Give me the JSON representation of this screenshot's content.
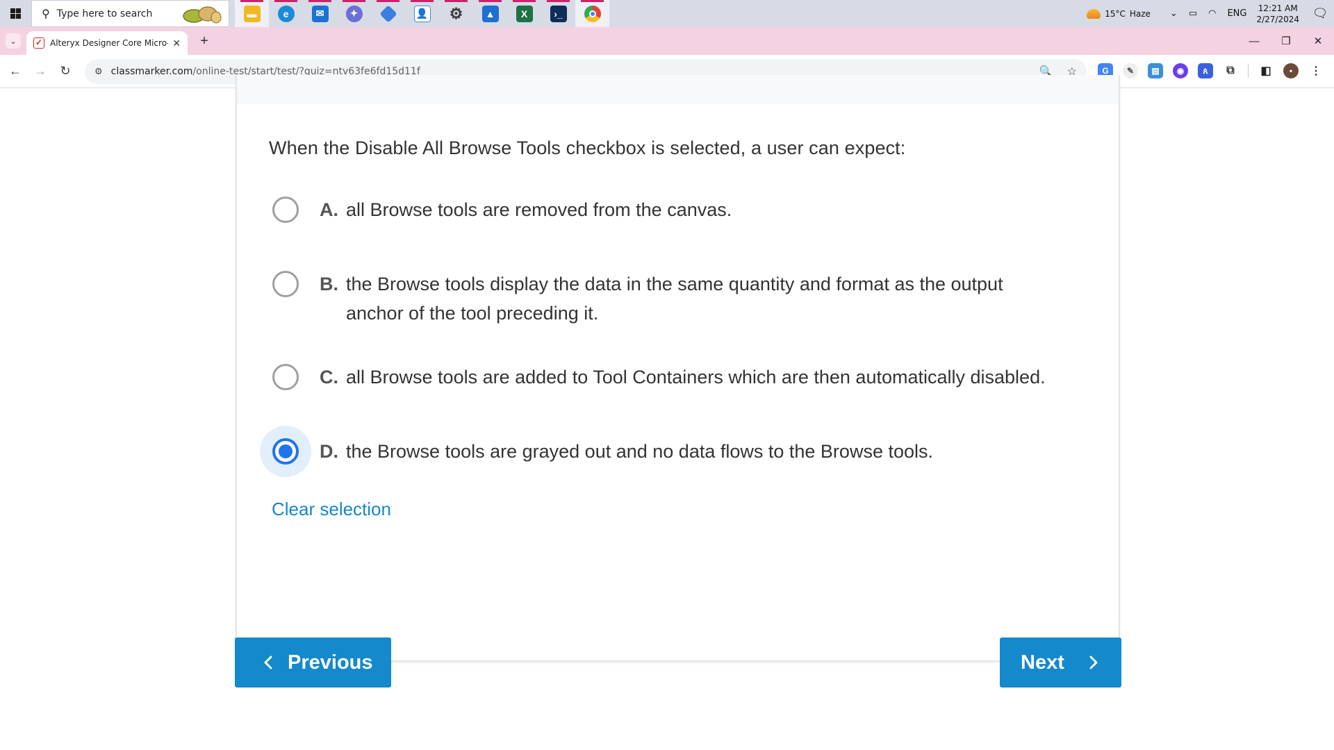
{
  "taskbar": {
    "search_placeholder": "Type here to search",
    "weather_temp": "15°C",
    "weather_text": "Haze",
    "language": "ENG",
    "time": "12:21 AM",
    "date": "2/27/2024",
    "apps": [
      {
        "name": "file-explorer",
        "color": "#f2b824"
      },
      {
        "name": "edge",
        "color": "#1c8ad6"
      },
      {
        "name": "mail",
        "color": "#1a73d1"
      },
      {
        "name": "copilot",
        "color": "#6b6fd6"
      },
      {
        "name": "teams-app",
        "color": "#3d7de0"
      },
      {
        "name": "contacts",
        "color": "#4a86d8"
      },
      {
        "name": "settings",
        "color": "#3b3b3b"
      },
      {
        "name": "photos",
        "color": "#1f6fd1"
      },
      {
        "name": "excel",
        "color": "#1e7145"
      },
      {
        "name": "powershell",
        "color": "#0f2d5a"
      },
      {
        "name": "chrome",
        "color": "#e54335"
      }
    ]
  },
  "browser": {
    "tab_title": "Alteryx Designer Core Micro-Cr",
    "url_host": "classmarker.com",
    "url_path": "/online-test/start/test/?quiz=ntv63fe6fd15d11f"
  },
  "quiz": {
    "question": "When the Disable All Browse Tools checkbox is selected, a user can expect:",
    "answers": [
      {
        "letter": "A.",
        "text": "all Browse tools are removed from the canvas.",
        "selected": false
      },
      {
        "letter": "B.",
        "text": "the Browse tools display the data in the same quantity and format as the output anchor of the tool preceding it.",
        "selected": false
      },
      {
        "letter": "C.",
        "text": "all Browse tools are added to Tool Containers which are then automatically disabled.",
        "selected": false
      },
      {
        "letter": "D.",
        "text": "the Browse tools are grayed out and no data flows to the Browse tools.",
        "selected": true
      }
    ],
    "clear_selection_label": "Clear selection",
    "previous_label": "Previous",
    "next_label": "Next"
  },
  "colors": {
    "accent": "#1489cc",
    "selected_radio": "#1f74ea",
    "tabstrip": "#f4d2e2"
  }
}
